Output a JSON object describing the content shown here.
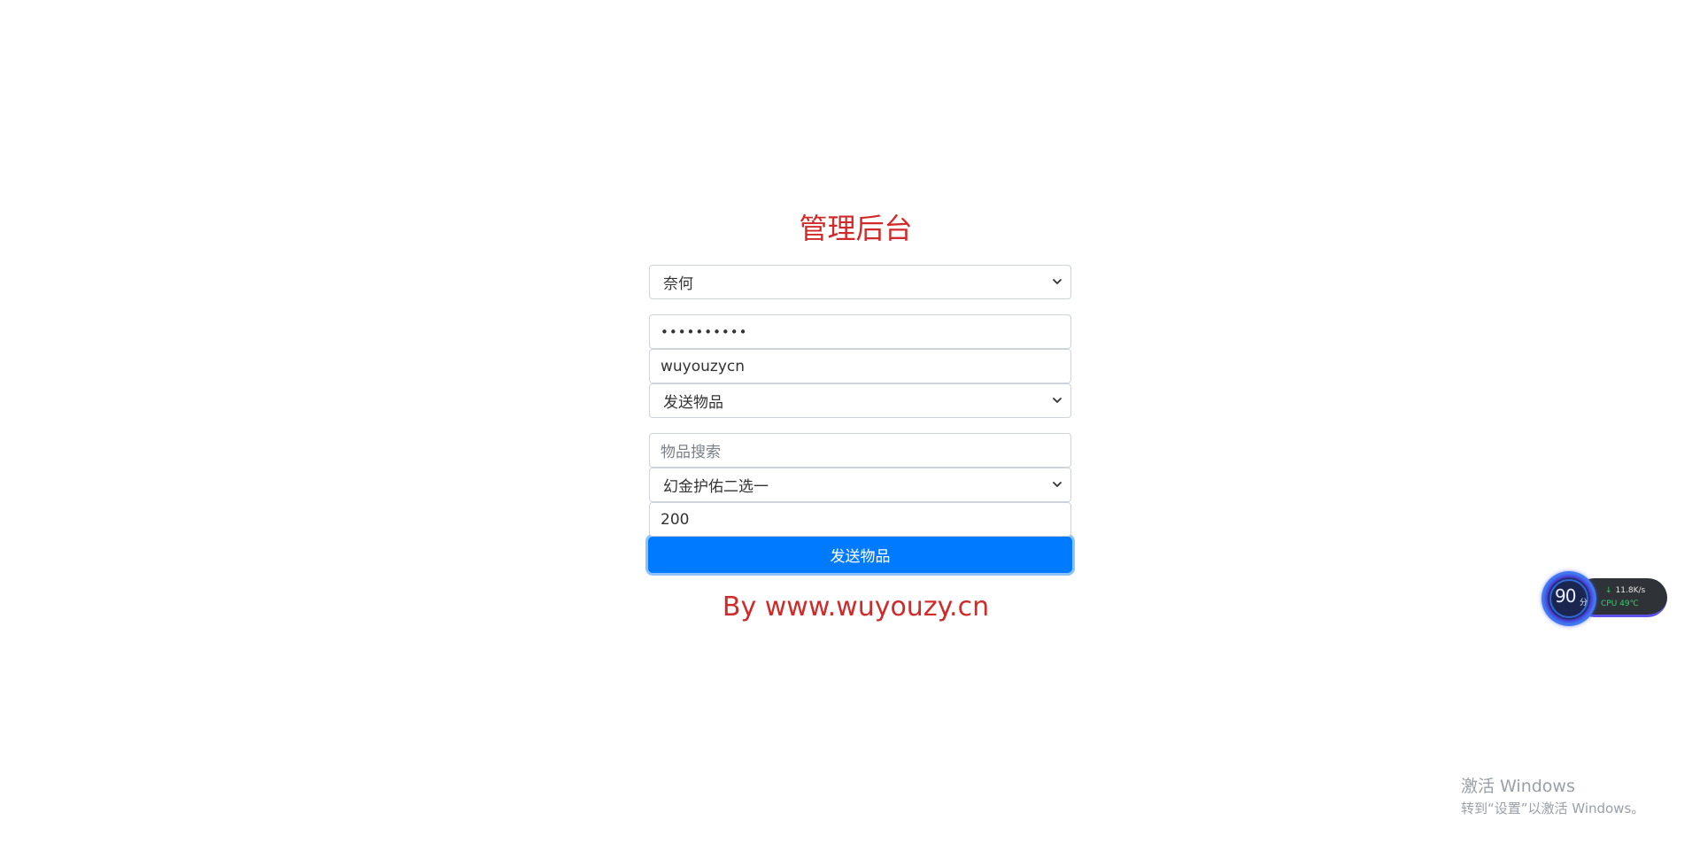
{
  "page": {
    "title": "管理后台",
    "footer": "By www.wuyouzy.cn"
  },
  "form": {
    "server_select": {
      "value": "奈何"
    },
    "password": {
      "value": "••••••••••"
    },
    "username": {
      "value": "wuyouzycn"
    },
    "action_select": {
      "value": "发送物品"
    },
    "item_search": {
      "value": "",
      "placeholder": "物品搜索"
    },
    "item_select": {
      "value": "幻金护佑二选一"
    },
    "quantity": {
      "value": "200"
    },
    "submit_label": "发送物品"
  },
  "widget": {
    "score": "90",
    "score_unit": "分",
    "network_speed": "11.8K/s",
    "cpu": "CPU 49℃"
  },
  "watermark": {
    "line1": "激活 Windows",
    "line2": "转到“设置”以激活 Windows。"
  },
  "colors": {
    "accent": "#007bff",
    "title_red": "#d02a2a"
  }
}
